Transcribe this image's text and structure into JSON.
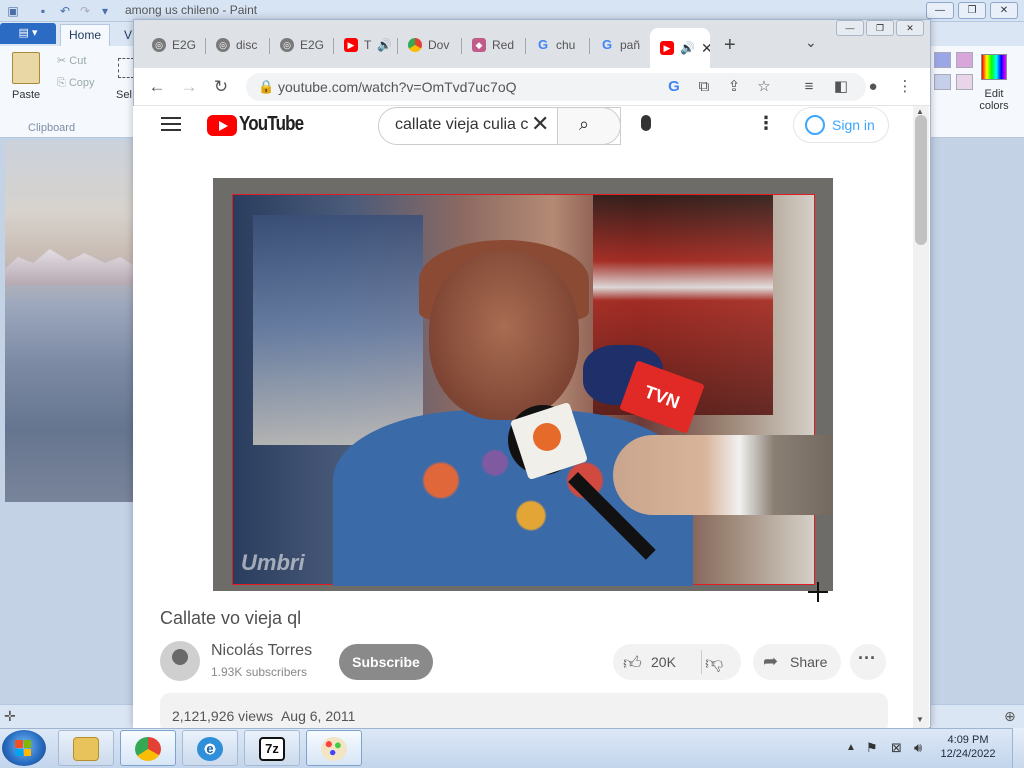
{
  "paint": {
    "title": "among us chileno - Paint",
    "tabs": {
      "home": "Home",
      "view": "V"
    },
    "clipboard": {
      "paste": "Paste",
      "cut": "Cut",
      "copy": "Copy",
      "group_label": "Clipboard"
    },
    "select_label": "Sel",
    "edit_colors_label": "Edit colors",
    "palette_colors": [
      "#9aa6e6",
      "#d8a6d8",
      "#c5cfe9",
      "#e8d6e8"
    ]
  },
  "chrome": {
    "tabs": [
      {
        "label": "E2G",
        "icon": "globe-icon",
        "color": "#7a7a7a"
      },
      {
        "label": "disc",
        "icon": "globe-icon",
        "color": "#7a7a7a"
      },
      {
        "label": "E2G",
        "icon": "globe-icon",
        "color": "#7a7a7a"
      },
      {
        "label": "T",
        "icon": "youtube-icon",
        "color": "#ff0000"
      },
      {
        "label": "Dov",
        "icon": "chrome-icon",
        "color": "#e34133"
      },
      {
        "label": "Red",
        "icon": "reddit-icon",
        "color": "#c15b8a"
      },
      {
        "label": "chu",
        "icon": "google-icon",
        "color": "#4285f4"
      },
      {
        "label": "pañ",
        "icon": "google-icon",
        "color": "#4285f4"
      },
      {
        "label": "",
        "icon": "youtube-icon",
        "color": "#ff0000",
        "active": true
      }
    ],
    "new_tab_symbol": "+",
    "url": "youtube.com/watch?v=OmTvd7uc7oQ"
  },
  "youtube": {
    "logo_text": "YouTube",
    "search_query": "callate vieja culia c",
    "sign_in": "Sign in",
    "video_watermark": "Umbri",
    "mic_logo_text": "TVN",
    "video_title": "Callate vo vieja ql",
    "channel_name": "Nicolás Torres",
    "subscribers": "1.93K subscribers",
    "subscribe_label": "Subscribe",
    "like_count": "20K",
    "share_label": "Share",
    "views": "2,121,926 views",
    "upload_date": "Aug 6, 2011"
  },
  "taskbar": {
    "apps": [
      {
        "name": "explorer",
        "icon": "folder-icon"
      },
      {
        "name": "chrome",
        "icon": "chrome-icon"
      },
      {
        "name": "ie",
        "icon": "ie-icon"
      },
      {
        "name": "7zip",
        "icon": "7zip-icon",
        "text": "7z"
      },
      {
        "name": "paint",
        "icon": "paint-icon"
      }
    ],
    "clock_time": "4:09 PM",
    "clock_date": "12/24/2022"
  }
}
